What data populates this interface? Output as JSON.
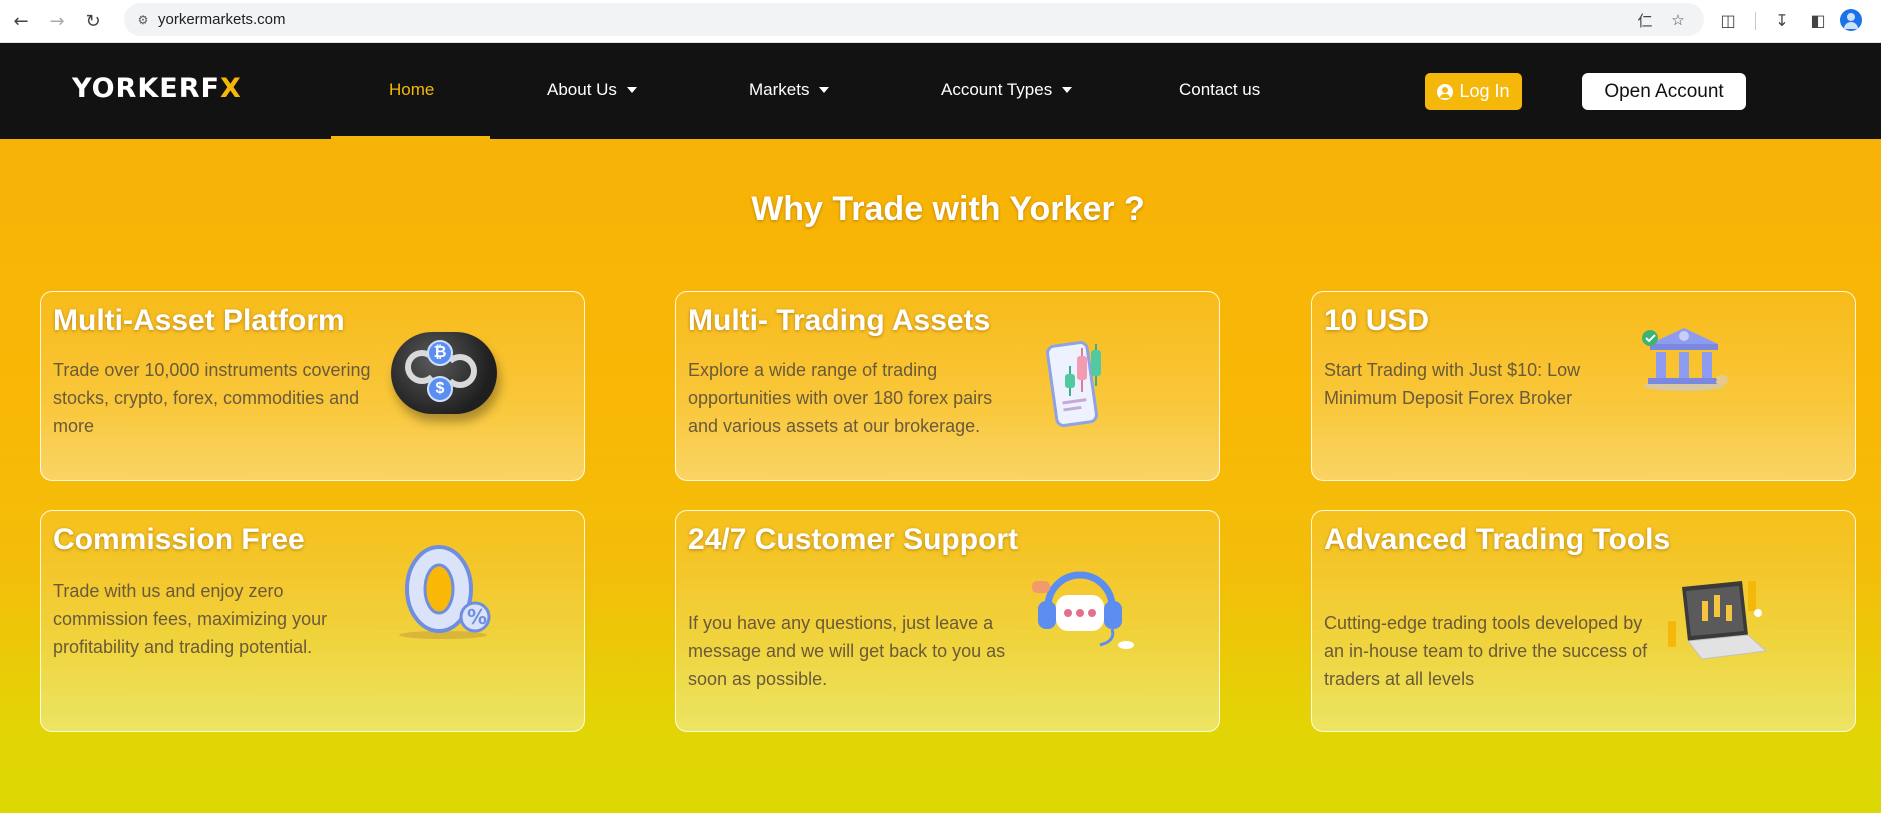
{
  "browser": {
    "url": "yorkermarkets.com"
  },
  "header": {
    "logo_main": "YORKERF",
    "logo_accent": "X",
    "nav": [
      {
        "label": "Home"
      },
      {
        "label": "About Us"
      },
      {
        "label": "Markets"
      },
      {
        "label": "Account Types"
      },
      {
        "label": "Contact us"
      }
    ],
    "login_label": "Log In",
    "open_account_label": "Open Account"
  },
  "main": {
    "title": "Why Trade with Yorker ?",
    "cards": [
      {
        "title": "Multi-Asset Platform",
        "desc": "Trade over 10,000 instruments covering stocks, crypto, forex, commodities and more",
        "icon": "crypto-exchange-icon"
      },
      {
        "title": "Multi- Trading Assets",
        "desc": "Explore a wide range of trading opportunities with over 180 forex pairs and various assets at our brokerage.",
        "icon": "phone-chart-icon"
      },
      {
        "title": "10 USD",
        "desc": "Start Trading with Just $10: Low Minimum Deposit Forex Broker",
        "icon": "bank-icon"
      },
      {
        "title": "Commission Free",
        "desc": "Trade with us and enjoy zero commission fees, maximizing your profitability and trading potential.",
        "icon": "zero-percent-icon"
      },
      {
        "title": "24/7 Customer Support",
        "desc": "If you have any questions, just leave a message and we will get back to you as soon as possible.",
        "icon": "headset-icon"
      },
      {
        "title": "Advanced Trading Tools",
        "desc": "Cutting-edge trading tools developed by an in-house team to drive the success of traders at all levels",
        "icon": "laptop-chart-icon"
      }
    ]
  },
  "colors": {
    "accent": "#f5b80a",
    "header_bg": "#121212"
  }
}
